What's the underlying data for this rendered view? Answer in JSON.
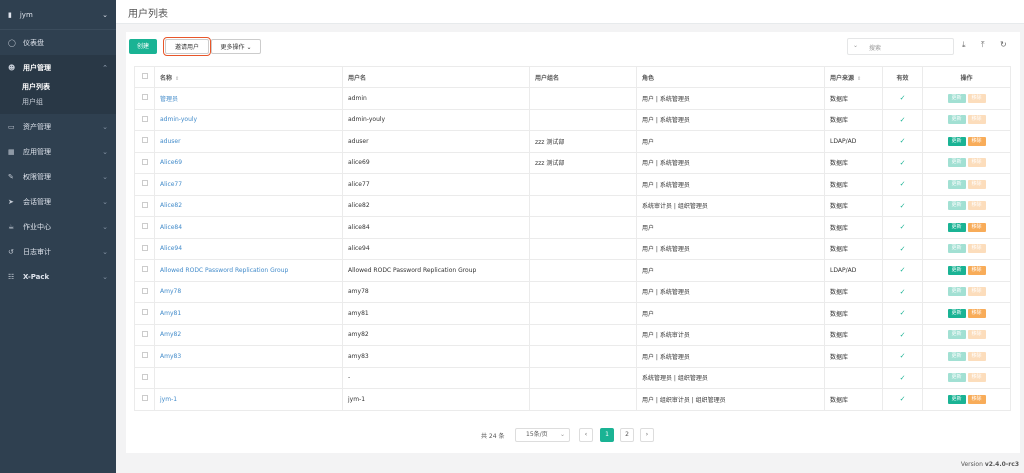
{
  "sidebar": {
    "org": "jym",
    "items": [
      {
        "label": "仪表盘",
        "icon": "dashboard-icon"
      },
      {
        "label": "用户管理",
        "icon": "users-icon"
      },
      {
        "label": "资产管理",
        "icon": "inbox-icon"
      },
      {
        "label": "应用管理",
        "icon": "apps-icon"
      },
      {
        "label": "权限管理",
        "icon": "edit-icon"
      },
      {
        "label": "会话管理",
        "icon": "rocket-icon"
      },
      {
        "label": "作业中心",
        "icon": "coffee-icon"
      },
      {
        "label": "日志审计",
        "icon": "history-icon"
      },
      {
        "label": "X-Pack",
        "icon": "sitemap-icon"
      }
    ],
    "user_sub": [
      "用户列表",
      "用户组"
    ]
  },
  "header": {
    "title": "用户列表"
  },
  "toolbar": {
    "create": "创建",
    "invite": "邀请用户",
    "more": "更多操作",
    "search_placeholder": "搜索"
  },
  "table": {
    "columns": [
      "名称",
      "用户名",
      "用户组名",
      "角色",
      "用户来源",
      "有效",
      "操作"
    ],
    "update_label": "更新",
    "remove_label": "移除",
    "rows": [
      {
        "name": "管理员",
        "username": "admin",
        "group": "",
        "role": "用户 | 系统管理员",
        "source": "数据库",
        "valid": true,
        "enabled": false
      },
      {
        "name": "admin-youly",
        "username": "admin-youly",
        "group": "",
        "role": "用户 | 系统管理员",
        "source": "数据库",
        "valid": true,
        "enabled": false
      },
      {
        "name": "aduser",
        "username": "aduser",
        "group": "zzz 测试部",
        "role": "用户",
        "source": "LDAP/AD",
        "valid": true,
        "enabled": true
      },
      {
        "name": "Alice69",
        "username": "alice69",
        "group": "zzz 测试部",
        "role": "用户 | 系统管理员",
        "source": "数据库",
        "valid": true,
        "enabled": false
      },
      {
        "name": "Alice77",
        "username": "alice77",
        "group": "",
        "role": "用户 | 系统管理员",
        "source": "数据库",
        "valid": true,
        "enabled": false
      },
      {
        "name": "Alice82",
        "username": "alice82",
        "group": "",
        "role": "系统审计员 | 组织管理员",
        "source": "数据库",
        "valid": true,
        "enabled": false
      },
      {
        "name": "Alice84",
        "username": "alice84",
        "group": "",
        "role": "用户",
        "source": "数据库",
        "valid": true,
        "enabled": true
      },
      {
        "name": "Alice94",
        "username": "alice94",
        "group": "",
        "role": "用户 | 系统管理员",
        "source": "数据库",
        "valid": true,
        "enabled": false
      },
      {
        "name": "Allowed RODC Password Replication Group",
        "username": "Allowed RODC Password Replication Group",
        "group": "",
        "role": "用户",
        "source": "LDAP/AD",
        "valid": true,
        "enabled": true
      },
      {
        "name": "Amy78",
        "username": "amy78",
        "group": "",
        "role": "用户 | 系统管理员",
        "source": "数据库",
        "valid": true,
        "enabled": false
      },
      {
        "name": "Amy81",
        "username": "amy81",
        "group": "",
        "role": "用户",
        "source": "数据库",
        "valid": true,
        "enabled": true
      },
      {
        "name": "Amy82",
        "username": "amy82",
        "group": "",
        "role": "用户 | 系统审计员",
        "source": "数据库",
        "valid": true,
        "enabled": false
      },
      {
        "name": "Amy83",
        "username": "amy83",
        "group": "",
        "role": "用户 | 系统管理员",
        "source": "数据库",
        "valid": true,
        "enabled": false
      },
      {
        "name": "",
        "username": "-",
        "group": "",
        "role": "系统管理员 | 组织管理员",
        "source": "",
        "valid": true,
        "enabled": false
      },
      {
        "name": "jym-1",
        "username": "jym-1",
        "group": "",
        "role": "用户 | 组织审计员 | 组织管理员",
        "source": "数据库",
        "valid": true,
        "enabled": true
      }
    ]
  },
  "pagination": {
    "total": "共 24 条",
    "page_size": "15条/页",
    "pages": [
      "1",
      "2"
    ],
    "current": "1"
  },
  "footer": {
    "version_label": "Version",
    "version": "v2.4.0-rc3"
  }
}
